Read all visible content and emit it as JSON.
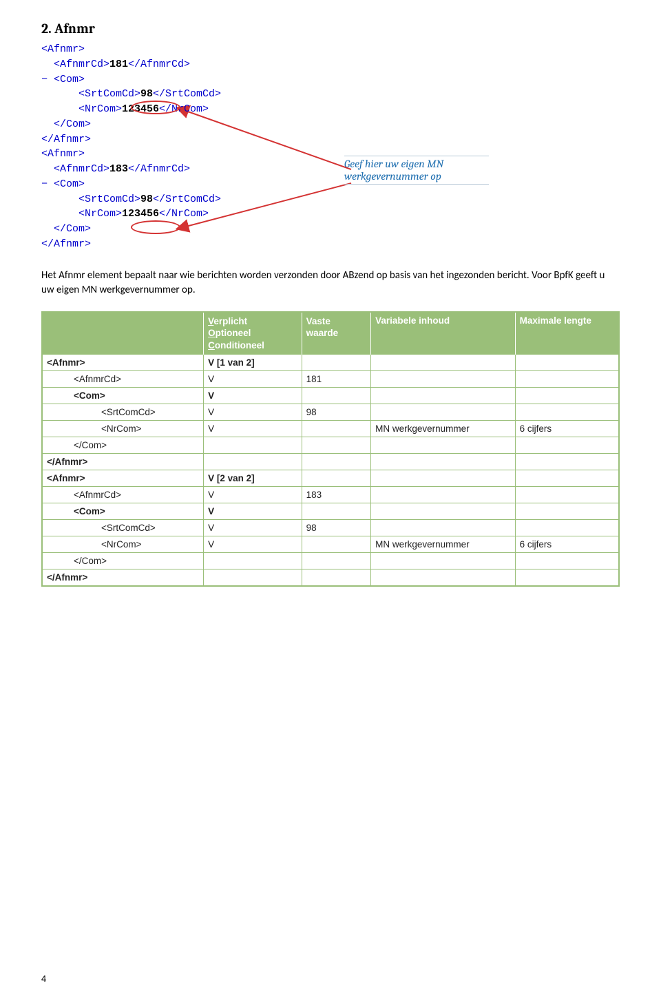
{
  "title": "2. Afnmr",
  "xml": {
    "afnmr_open": "<Afnmr>",
    "afnmr_close": "</Afnmr>",
    "afnmrcd_181": "<AfnmrCd>181</AfnmrCd>",
    "afnmrcd_183": "<AfnmrCd>183</AfnmrCd>",
    "com_open": "<Com>",
    "com_close": "</Com>",
    "srtcomcd": "<SrtComCd>98</SrtComCd>",
    "nrcom_open": "<NrCom>",
    "nrcom_close": "</NrCom>",
    "nrcom_value": "123456"
  },
  "annotation": {
    "line1": "Geef hier uw eigen MN",
    "line2": "werkgevernummer op"
  },
  "body_text": "Het Afnmr element bepaalt naar wie berichten worden verzonden door ABzend op basis van het ingezonden bericht. Voor BpfK geeft u uw eigen MN werkgevernummer op.",
  "table": {
    "headers": {
      "col1": "",
      "col2_l1": "Verplicht",
      "col2_l2": "Optioneel",
      "col2_l3": "Conditioneel",
      "col3_l1": "Vaste",
      "col3_l2": "waarde",
      "col4": "Variabele inhoud",
      "col5": "Maximale lengte"
    },
    "rows": [
      {
        "c1": "<Afnmr>",
        "indent": 0,
        "c2": "V [1 van 2]",
        "c3": "",
        "c4": "",
        "c5": "",
        "bold": true
      },
      {
        "c1": "<AfnmrCd>",
        "indent": 1,
        "c2": "V",
        "c3": "181",
        "c4": "",
        "c5": ""
      },
      {
        "c1": "<Com>",
        "indent": 1,
        "c2": "V",
        "c3": "",
        "c4": "",
        "c5": "",
        "bold": true
      },
      {
        "c1": "<SrtComCd>",
        "indent": 2,
        "c2": "V",
        "c3": "98",
        "c4": "",
        "c5": ""
      },
      {
        "c1": "<NrCom>",
        "indent": 2,
        "c2": "V",
        "c3": "",
        "c4": "MN werkgevernummer",
        "c5": "6 cijfers"
      },
      {
        "c1": "</Com>",
        "indent": 1,
        "c2": "",
        "c3": "",
        "c4": "",
        "c5": ""
      },
      {
        "c1": "</Afnmr>",
        "indent": 0,
        "c2": "",
        "c3": "",
        "c4": "",
        "c5": "",
        "bold": true
      },
      {
        "c1": "<Afnmr>",
        "indent": 0,
        "c2": "V [2 van 2]",
        "c3": "",
        "c4": "",
        "c5": "",
        "bold": true
      },
      {
        "c1": "<AfnmrCd>",
        "indent": 1,
        "c2": "V",
        "c3": "183",
        "c4": "",
        "c5": ""
      },
      {
        "c1": "<Com>",
        "indent": 1,
        "c2": "V",
        "c3": "",
        "c4": "",
        "c5": "",
        "bold": true
      },
      {
        "c1": "<SrtComCd>",
        "indent": 2,
        "c2": "V",
        "c3": "98",
        "c4": "",
        "c5": ""
      },
      {
        "c1": "<NrCom>",
        "indent": 2,
        "c2": "V",
        "c3": "",
        "c4": "MN werkgevernummer",
        "c5": "6 cijfers"
      },
      {
        "c1": "</Com>",
        "indent": 1,
        "c2": "",
        "c3": "",
        "c4": "",
        "c5": ""
      },
      {
        "c1": "</Afnmr>",
        "indent": 0,
        "c2": "",
        "c3": "",
        "c4": "",
        "c5": "",
        "bold": true
      }
    ]
  },
  "page_number": "4"
}
